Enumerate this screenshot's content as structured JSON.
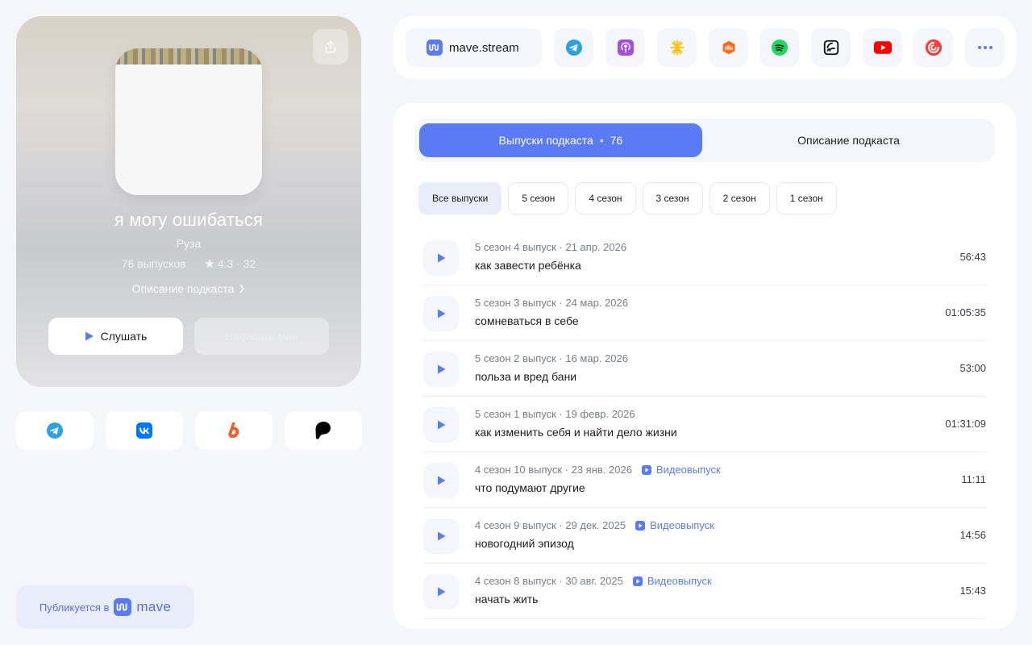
{
  "podcast": {
    "title": "я могу ошибаться",
    "author": "Руза",
    "episodes_count": "76 выпусков",
    "rating": "4.3 · 32",
    "description_link": "Описание подкаста",
    "listen_label": "Слушать",
    "write_label": "Написать мне"
  },
  "socials": [
    "telegram-icon",
    "vk-icon",
    "boosty-icon",
    "patreon-icon"
  ],
  "published": {
    "label": "Публикуется в",
    "logo": "mave"
  },
  "platforms": {
    "mave_label": "mave.stream",
    "items": [
      "telegram-icon",
      "apple-podcasts-icon",
      "yandex-music-icon",
      "soundcloud-icon",
      "spotify-icon",
      "castbox-icon",
      "youtube-icon",
      "pocket-casts-icon",
      "more-icon"
    ]
  },
  "tabs": {
    "episodes_label": "Выпуски подкаста",
    "episodes_count": "76",
    "description_label": "Описание подкаста"
  },
  "filters": [
    "Все выпуски",
    "5 сезон",
    "4 сезон",
    "3 сезон",
    "2 сезон",
    "1 сезон"
  ],
  "episodes": [
    {
      "meta": "5 сезон 4 выпуск · 21 апр. 2026",
      "title": "как завести ребёнка",
      "duration": "56:43",
      "video": ""
    },
    {
      "meta": "5 сезон 3 выпуск · 24 мар. 2026",
      "title": "сомневаться в себе",
      "duration": "01:05:35",
      "video": ""
    },
    {
      "meta": "5 сезон 2 выпуск · 16 мар. 2026",
      "title": "польза и вред бани",
      "duration": "53:00",
      "video": ""
    },
    {
      "meta": "5 сезон 1 выпуск · 19 февр. 2026",
      "title": "как изменить себя и найти дело жизни",
      "duration": "01:31:09",
      "video": ""
    },
    {
      "meta": "4 сезон 10 выпуск · 23 янв. 2026",
      "title": "что подумают другие",
      "duration": "11:11",
      "video": "Видеовыпуск"
    },
    {
      "meta": "4 сезон 9 выпуск · 29 дек. 2025",
      "title": "новогодний эпизод",
      "duration": "14:56",
      "video": "Видеовыпуск"
    },
    {
      "meta": "4 сезон 8 выпуск · 30 авг. 2025",
      "title": "начать жить",
      "duration": "15:43",
      "video": "Видеовыпуск"
    }
  ],
  "colors": {
    "accent": "#5b7bf5",
    "background": "#f4f6fb"
  }
}
